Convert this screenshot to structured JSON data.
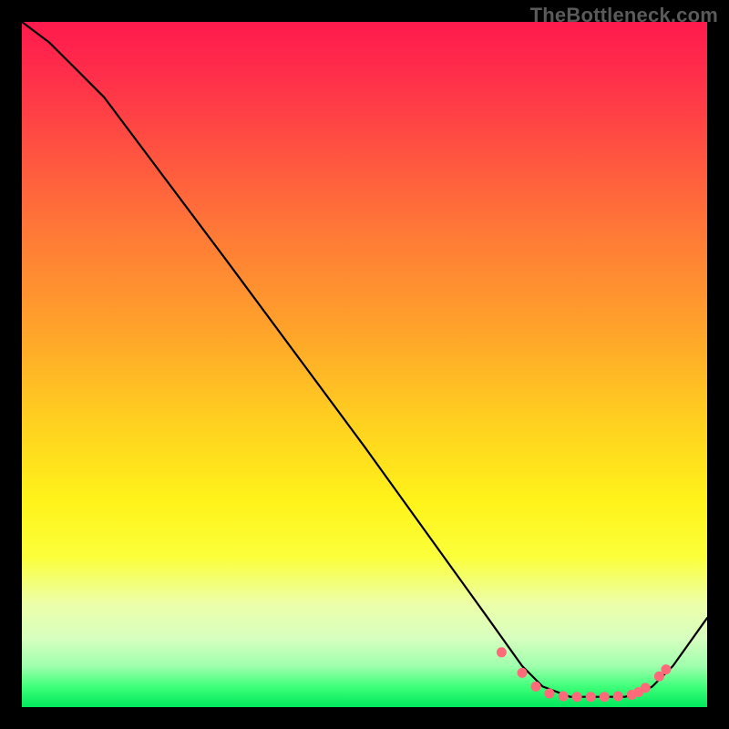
{
  "watermark": "TheBottleneck.com",
  "chart_data": {
    "type": "line",
    "title": "",
    "xlabel": "",
    "ylabel": "",
    "xlim": [
      0,
      100
    ],
    "ylim": [
      0,
      100
    ],
    "series": [
      {
        "name": "curve",
        "x": [
          0,
          4,
          8,
          12,
          30,
          50,
          68,
          73,
          76,
          80,
          84,
          88,
          90,
          92,
          95,
          100
        ],
        "y": [
          100,
          97,
          93,
          89,
          65,
          38,
          13,
          6,
          3,
          1.5,
          1.5,
          1.5,
          2,
          3,
          6,
          13
        ]
      }
    ],
    "markers": {
      "name": "valley-dots",
      "color": "#ff6a7a",
      "x": [
        70,
        73,
        75,
        77,
        79,
        81,
        83,
        85,
        87,
        89,
        90,
        91,
        93,
        94
      ],
      "y": [
        8,
        5,
        3,
        2,
        1.6,
        1.5,
        1.5,
        1.5,
        1.6,
        1.8,
        2.2,
        2.8,
        4.5,
        5.5
      ]
    },
    "background": {
      "gradient": "vertical-rainbow",
      "stops": [
        "#ff1a4d",
        "#ff7d36",
        "#ffcf20",
        "#fff31a",
        "#9fffad",
        "#00e85c"
      ]
    }
  }
}
